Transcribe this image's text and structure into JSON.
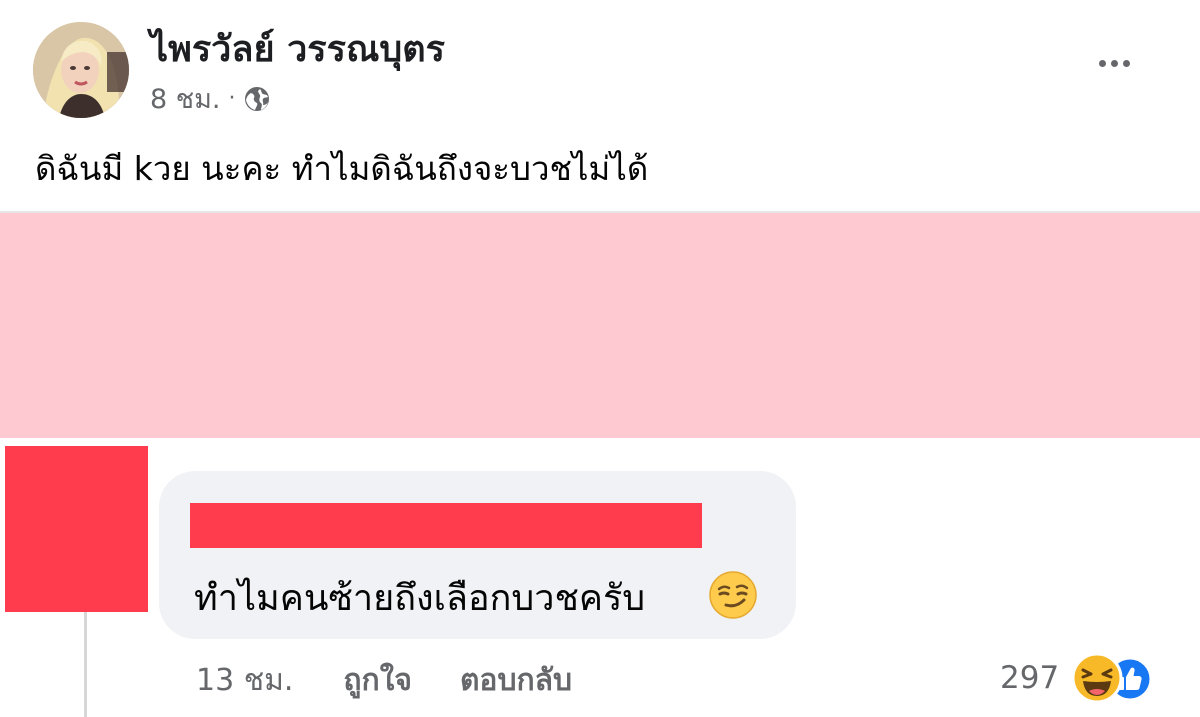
{
  "post": {
    "author_name": "ไพรวัลย์ วรรณบุตร",
    "timestamp": "8 ชม.",
    "separator": "·",
    "privacy_icon": "globe-icon",
    "text": "ดิฉันมี kวย นะคะ ทำไมดิฉันถึงจะบวชไม่ได้",
    "more_icon": "more-horizontal-icon"
  },
  "comment": {
    "text": "ทำไมคนซ้ายถึงเลือกบวชครับ",
    "emoji": "smirk-emoji",
    "timestamp": "13 ชม.",
    "like_label": "ถูกใจ",
    "reply_label": "ตอบกลับ",
    "reaction_count": "297",
    "reaction_icons": [
      "haha-icon",
      "like-icon"
    ]
  },
  "colors": {
    "redaction_red": "#ff3b4e",
    "redaction_pink": "#ffc9d2",
    "bubble": "#f0f2f5",
    "secondary_text": "#65676b",
    "like_blue": "#1877f2",
    "haha_yellow": "#f7b928"
  }
}
